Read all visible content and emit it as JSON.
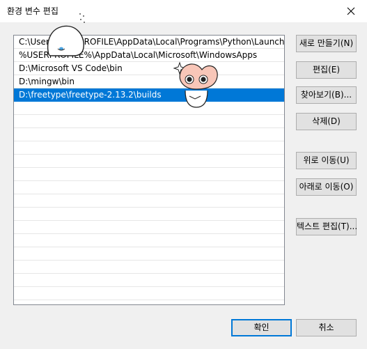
{
  "window": {
    "title": "환경 변수 편집"
  },
  "list": {
    "items": [
      "C:\\Users\\USERPROFILE\\AppData\\Local\\Programs\\Python\\Launcher\\",
      "%USERPROFILE%\\AppData\\Local\\Microsoft\\WindowsApps",
      "D:\\Microsoft VS Code\\bin",
      "D:\\mingw\\bin",
      "D:\\freetype\\freetype-2.13.2\\builds"
    ],
    "selected_index": 4
  },
  "buttons": {
    "new": "새로 만들기(N)",
    "edit": "편집(E)",
    "browse": "찾아보기(B)...",
    "delete": "삭제(D)",
    "move_up": "위로 이동(U)",
    "move_down": "아래로 이동(O)",
    "edit_text": "텍스트 편집(T)...",
    "ok": "확인",
    "cancel": "취소"
  },
  "colors": {
    "selection": "#0078d7",
    "button_face": "#e1e1e1"
  },
  "icons": {
    "close": "close-icon"
  }
}
